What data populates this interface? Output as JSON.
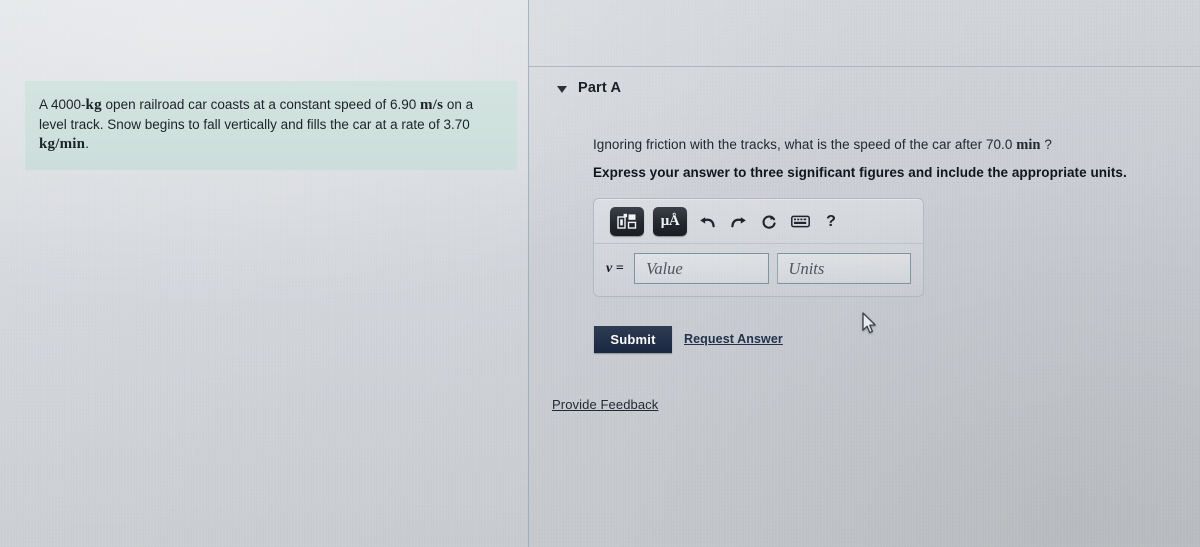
{
  "problem": {
    "line1_prefix": "A 4000-",
    "line1_unit_mass": "kg",
    "line1_mid": " open railroad car coasts at a constant speed of 6.90 ",
    "line1_unit_speed": "m/s",
    "line1_suffix": " on a level track. Snow begins to fall vertically and fills the car at a rate of ",
    "line2_value": "3.70 ",
    "line2_unit_rate": "kg/min",
    "line2_suffix": "."
  },
  "part": {
    "caret_icon": "caret-down-icon",
    "title": "Part A",
    "question_prefix": "Ignoring friction with the tracks, what is the speed of the car after 70.0 ",
    "question_unit": "min",
    "question_suffix": " ?",
    "instruction": "Express your answer to three significant figures and include the appropriate units."
  },
  "answer_widget": {
    "toolbar": [
      {
        "name": "math-template-icon",
        "label": "template",
        "style": "dark"
      },
      {
        "name": "units-icon",
        "label": "μÅ",
        "style": "dark"
      },
      {
        "name": "undo-icon",
        "label": "undo",
        "style": "plain"
      },
      {
        "name": "redo-icon",
        "label": "redo",
        "style": "plain"
      },
      {
        "name": "reset-icon",
        "label": "reset",
        "style": "plain"
      },
      {
        "name": "keyboard-icon",
        "label": "keyboard",
        "style": "plain"
      },
      {
        "name": "help-icon",
        "label": "?",
        "style": "plain"
      }
    ],
    "variable_label": "v =",
    "value_placeholder": "Value",
    "value_current": "",
    "units_placeholder": "Units",
    "units_current": ""
  },
  "actions": {
    "submit_label": "Submit",
    "request_answer_label": "Request Answer",
    "provide_feedback_label": "Provide Feedback"
  },
  "cursor": {
    "icon": "mouse-pointer-icon"
  },
  "colors": {
    "problem_card_bg": "#cfe1dd",
    "submit_bg": "#22304a",
    "link": "#22324d",
    "page_bg": "#cbcfd5",
    "field_border": "#7d95a3"
  }
}
